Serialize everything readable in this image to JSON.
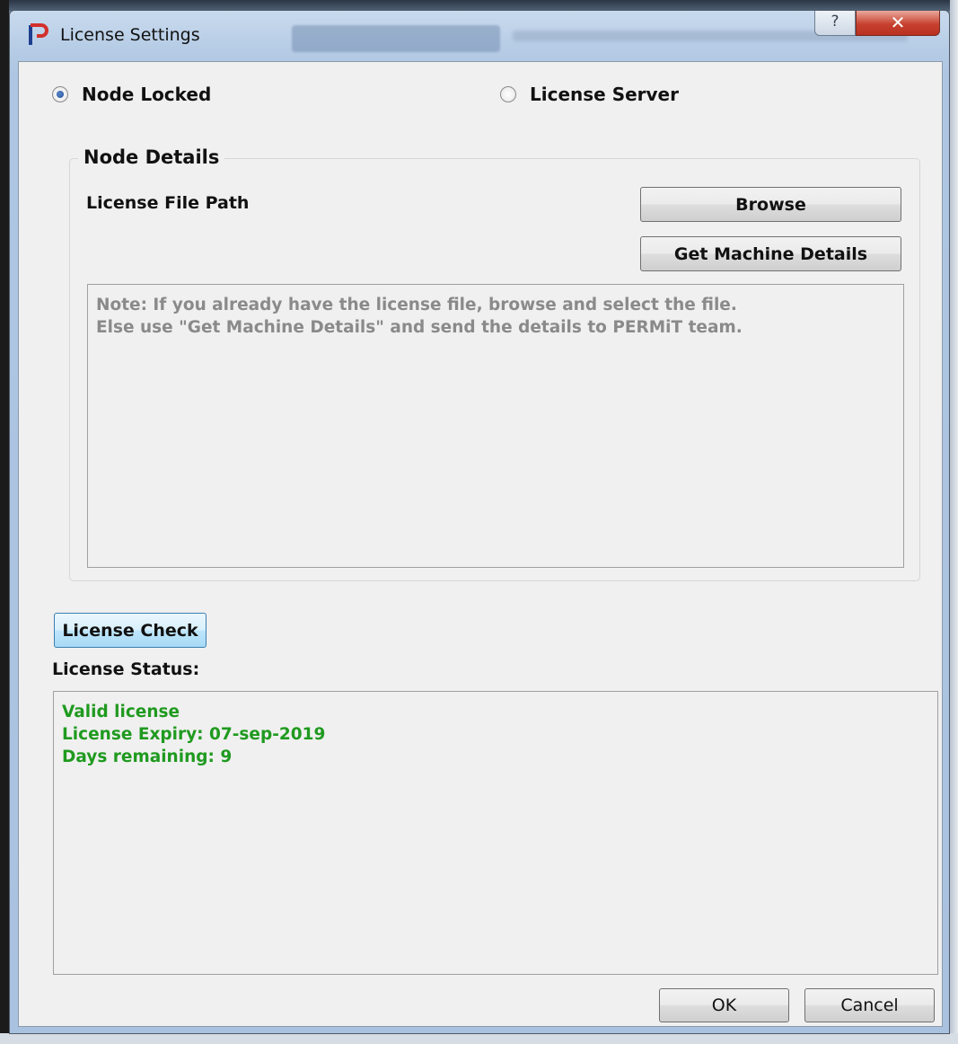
{
  "window": {
    "title": "License Settings",
    "help_glyph": "?",
    "close_glyph": "✕"
  },
  "mode": {
    "options": [
      {
        "label": "Node Locked",
        "selected": true
      },
      {
        "label": "License Server",
        "selected": false
      }
    ]
  },
  "node_details": {
    "group_title": "Node Details",
    "license_file_path_label": "License File Path",
    "browse_label": "Browse",
    "get_machine_details_label": "Get Machine Details",
    "note_lines": [
      "Note: If you already have the license file, browse and select the file.",
      "Else use \"Get Machine Details\" and send the details to PERMiT team."
    ]
  },
  "license_check": {
    "button_label": "License Check",
    "status_label": "License Status:",
    "status_lines": [
      "Valid license",
      "License Expiry: 07-sep-2019",
      "Days remaining: 9"
    ],
    "status_color": "#1f9a1f"
  },
  "footer": {
    "ok_label": "OK",
    "cancel_label": "Cancel"
  },
  "colors": {
    "titlebar": "#b7cde6",
    "client_background": "#f0f0f0",
    "close_button": "#c7412f",
    "note_text": "#8a8a8a"
  }
}
